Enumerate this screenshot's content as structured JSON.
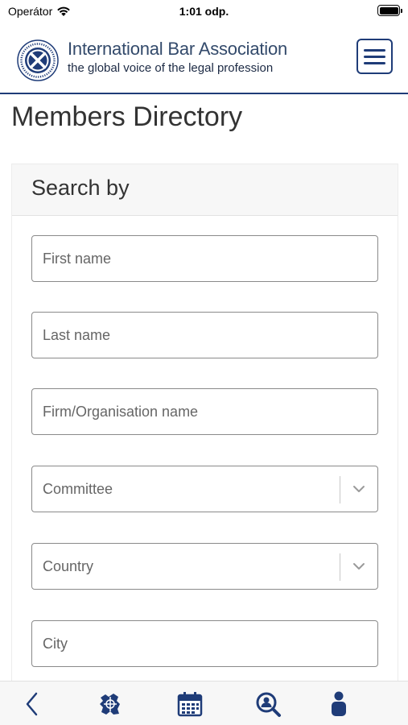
{
  "status_bar": {
    "carrier": "Operátor",
    "time": "1:01 odp."
  },
  "header": {
    "brand_name": "International Bar Association",
    "brand_tagline": "the global voice of the legal profession",
    "menu_icon": "hamburger-menu-icon"
  },
  "page": {
    "title": "Members Directory"
  },
  "search": {
    "title": "Search by",
    "fields": {
      "first_name": "First name",
      "last_name": "Last name",
      "firm": "Firm/Organisation name",
      "committee": "Committee",
      "country": "Country",
      "city": "City"
    }
  },
  "tab_bar": {
    "icons": [
      "back-chevron-icon",
      "globe-map-icon",
      "calendar-icon",
      "people-search-icon",
      "profile-icon"
    ]
  },
  "colors": {
    "brand_navy": "#1f3c78",
    "text_grey": "#333333",
    "border_grey": "#8a8a8a"
  }
}
